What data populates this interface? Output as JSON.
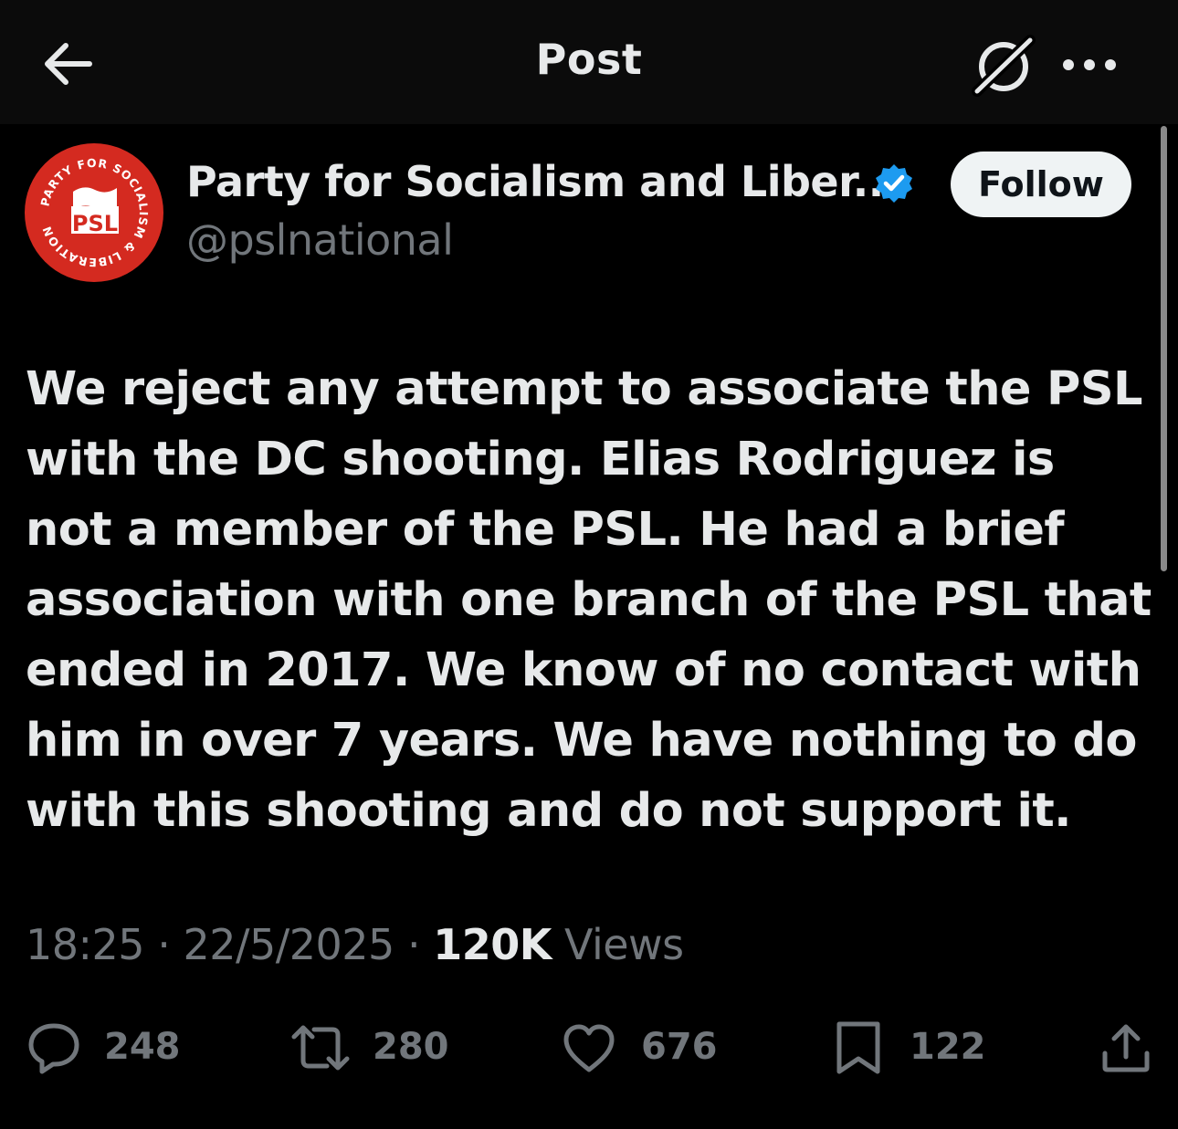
{
  "header": {
    "title": "Post",
    "back_icon": "arrow-left-icon",
    "grok_icon": "grok-icon",
    "more_icon": "more-horizontal-icon"
  },
  "author": {
    "display_name": "Party for Socialism and Liber...",
    "handle": "@pslnational",
    "verified": true,
    "avatar": {
      "ring_text": "PARTY FOR SOCIALISM & LIBERATION",
      "logo_text": "PSL",
      "color": "#d42a20"
    },
    "follow_label": "Follow"
  },
  "post": {
    "text": "We reject any attempt to associate the PSL with the DC shooting. Elias Rodriguez is not a member of the PSL. He had a brief association with one branch of the PSL that ended in 2017. We know of no contact with him in over 7 years. We have nothing to do with this shooting and do not support it.",
    "time": "18:25",
    "date": "22/5/2025",
    "separator": "·",
    "views_count": "120K",
    "views_label": "Views"
  },
  "actions": {
    "replies": "248",
    "reposts": "280",
    "likes": "676",
    "bookmarks": "122"
  },
  "colors": {
    "background": "#000000",
    "text": "#e7e9ea",
    "muted": "#71767b",
    "verified": "#1d9bf0",
    "follow_bg": "#eff3f4"
  }
}
